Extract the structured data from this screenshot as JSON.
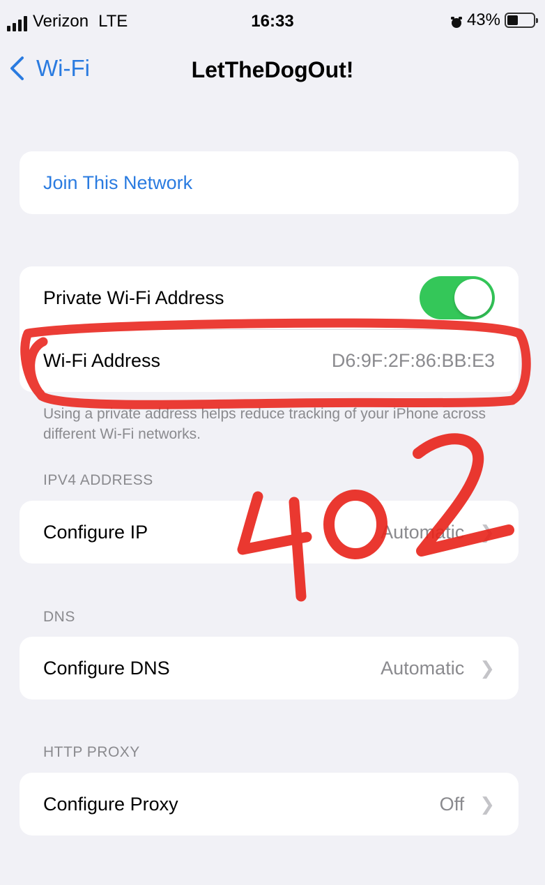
{
  "status_bar": {
    "carrier": "Verizon",
    "network": "LTE",
    "time": "16:33",
    "battery": "43%",
    "battery_level": 0.43
  },
  "nav": {
    "back_label": "Wi-Fi",
    "title": "LetTheDogOut!"
  },
  "join_card": {
    "label": "Join This Network"
  },
  "private_card": {
    "private_label": "Private Wi-Fi Address",
    "private_enabled": true,
    "address_label": "Wi-Fi Address",
    "address_value": "D6:9F:2F:86:BB:E3"
  },
  "private_footnote": "Using a private address helps reduce tracking of your iPhone across different Wi-Fi networks.",
  "ipv4": {
    "header": "IPV4 ADDRESS",
    "label": "Configure IP",
    "value": "Automatic"
  },
  "dns": {
    "header": "DNS",
    "label": "Configure DNS",
    "value": "Automatic"
  },
  "proxy": {
    "header": "HTTP PROXY",
    "label": "Configure Proxy",
    "value": "Off"
  },
  "annotation": {
    "text": "402",
    "color": "#e8221a"
  },
  "colors": {
    "accent": "#2a7be0",
    "toggle_on": "#34c759",
    "background": "#f1f1f6"
  }
}
